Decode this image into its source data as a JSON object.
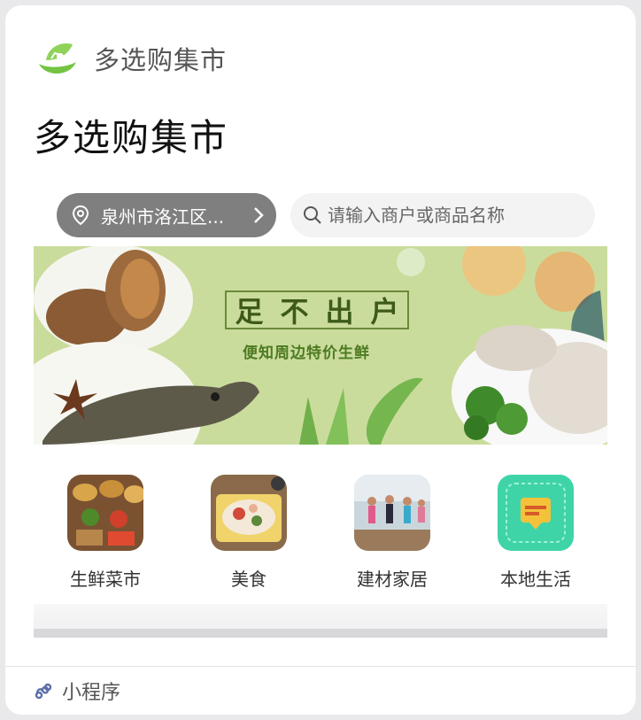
{
  "header": {
    "app_name": "多选购集市",
    "logo_icon": "leaf-cart-logo"
  },
  "page": {
    "title": "多选购集市"
  },
  "location": {
    "text": "泉州市洛江区...",
    "icon": "location-pin-icon"
  },
  "search": {
    "placeholder": "请输入商户或商品名称",
    "value": ""
  },
  "banner": {
    "title_chars": [
      "足",
      "不",
      "出",
      "户"
    ],
    "subtitle": "便知周边特价生鲜"
  },
  "categories": [
    {
      "label": "生鲜菜市"
    },
    {
      "label": "美食"
    },
    {
      "label": "建材家居"
    },
    {
      "label": "本地生活"
    }
  ],
  "footer": {
    "label": "小程序"
  },
  "colors": {
    "accent": "#74c442",
    "pill": "#7f7f7f",
    "banner_bg": "#cadc9c"
  }
}
